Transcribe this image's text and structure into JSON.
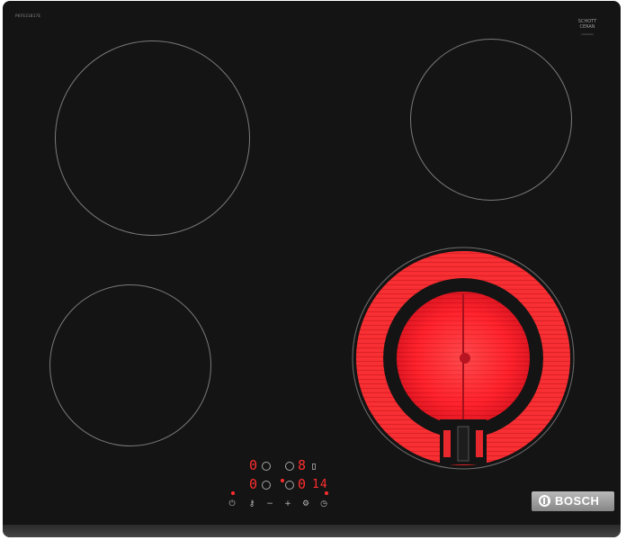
{
  "image": {
    "subject": "ceramic cooktop",
    "model_code": "PKF631B17E",
    "glass_brand_line1": "SCHOTT",
    "glass_brand_line2": "CERAN",
    "glass_brand_small": "collection",
    "brand": "BOSCH"
  },
  "display": {
    "zone_front_left_level": "0",
    "zone_rear_left_level": "0",
    "zone_front_right_level": "0",
    "zone_rear_right_level": "8",
    "timer_value": "14"
  },
  "controls": {
    "power_icon": "power-icon",
    "key_icon": "key-icon",
    "minus": "−",
    "plus": "+",
    "timer_icon": "clock-icon"
  },
  "colors": {
    "glass": "#141414",
    "heating_red": "#ff2e2e",
    "zone_outline": "#7a7a7a"
  }
}
